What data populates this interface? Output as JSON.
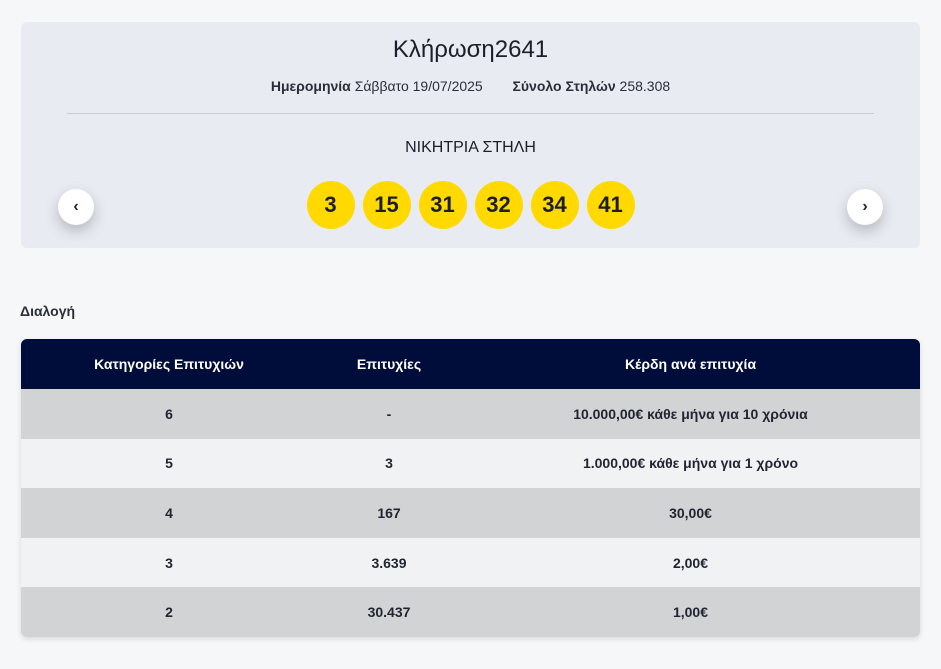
{
  "draw": {
    "title_word": "Κλήρωση",
    "number": "2641",
    "date_label": "Ημερομηνία",
    "date_value": "Σάββατο 19/07/2025",
    "columns_label": "Σύνολο Στηλών",
    "columns_value": "258.308",
    "winning_title": "ΝΙΚΗΤΡΙΑ ΣΤΗΛΗ",
    "numbers": [
      "3",
      "15",
      "31",
      "32",
      "34",
      "41"
    ],
    "prev_icon": "‹",
    "next_icon": "›"
  },
  "section": {
    "label": "Διαλογή"
  },
  "table": {
    "headers": [
      "Κατηγορίες Επιτυχιών",
      "Επιτυχίες",
      "Κέρδη ανά επιτυχία"
    ],
    "rows": [
      [
        "6",
        "-",
        "10.000,00€ κάθε μήνα για 10 χρόνια"
      ],
      [
        "5",
        "3",
        "1.000,00€ κάθε μήνα για 1 χρόνο"
      ],
      [
        "4",
        "167",
        "30,00€"
      ],
      [
        "3",
        "3.639",
        "2,00€"
      ],
      [
        "2",
        "30.437",
        "1,00€"
      ]
    ]
  },
  "colors": {
    "ball": "#ffd900",
    "table_header": "#000d3a",
    "card_bg": "#e8ebf2"
  }
}
